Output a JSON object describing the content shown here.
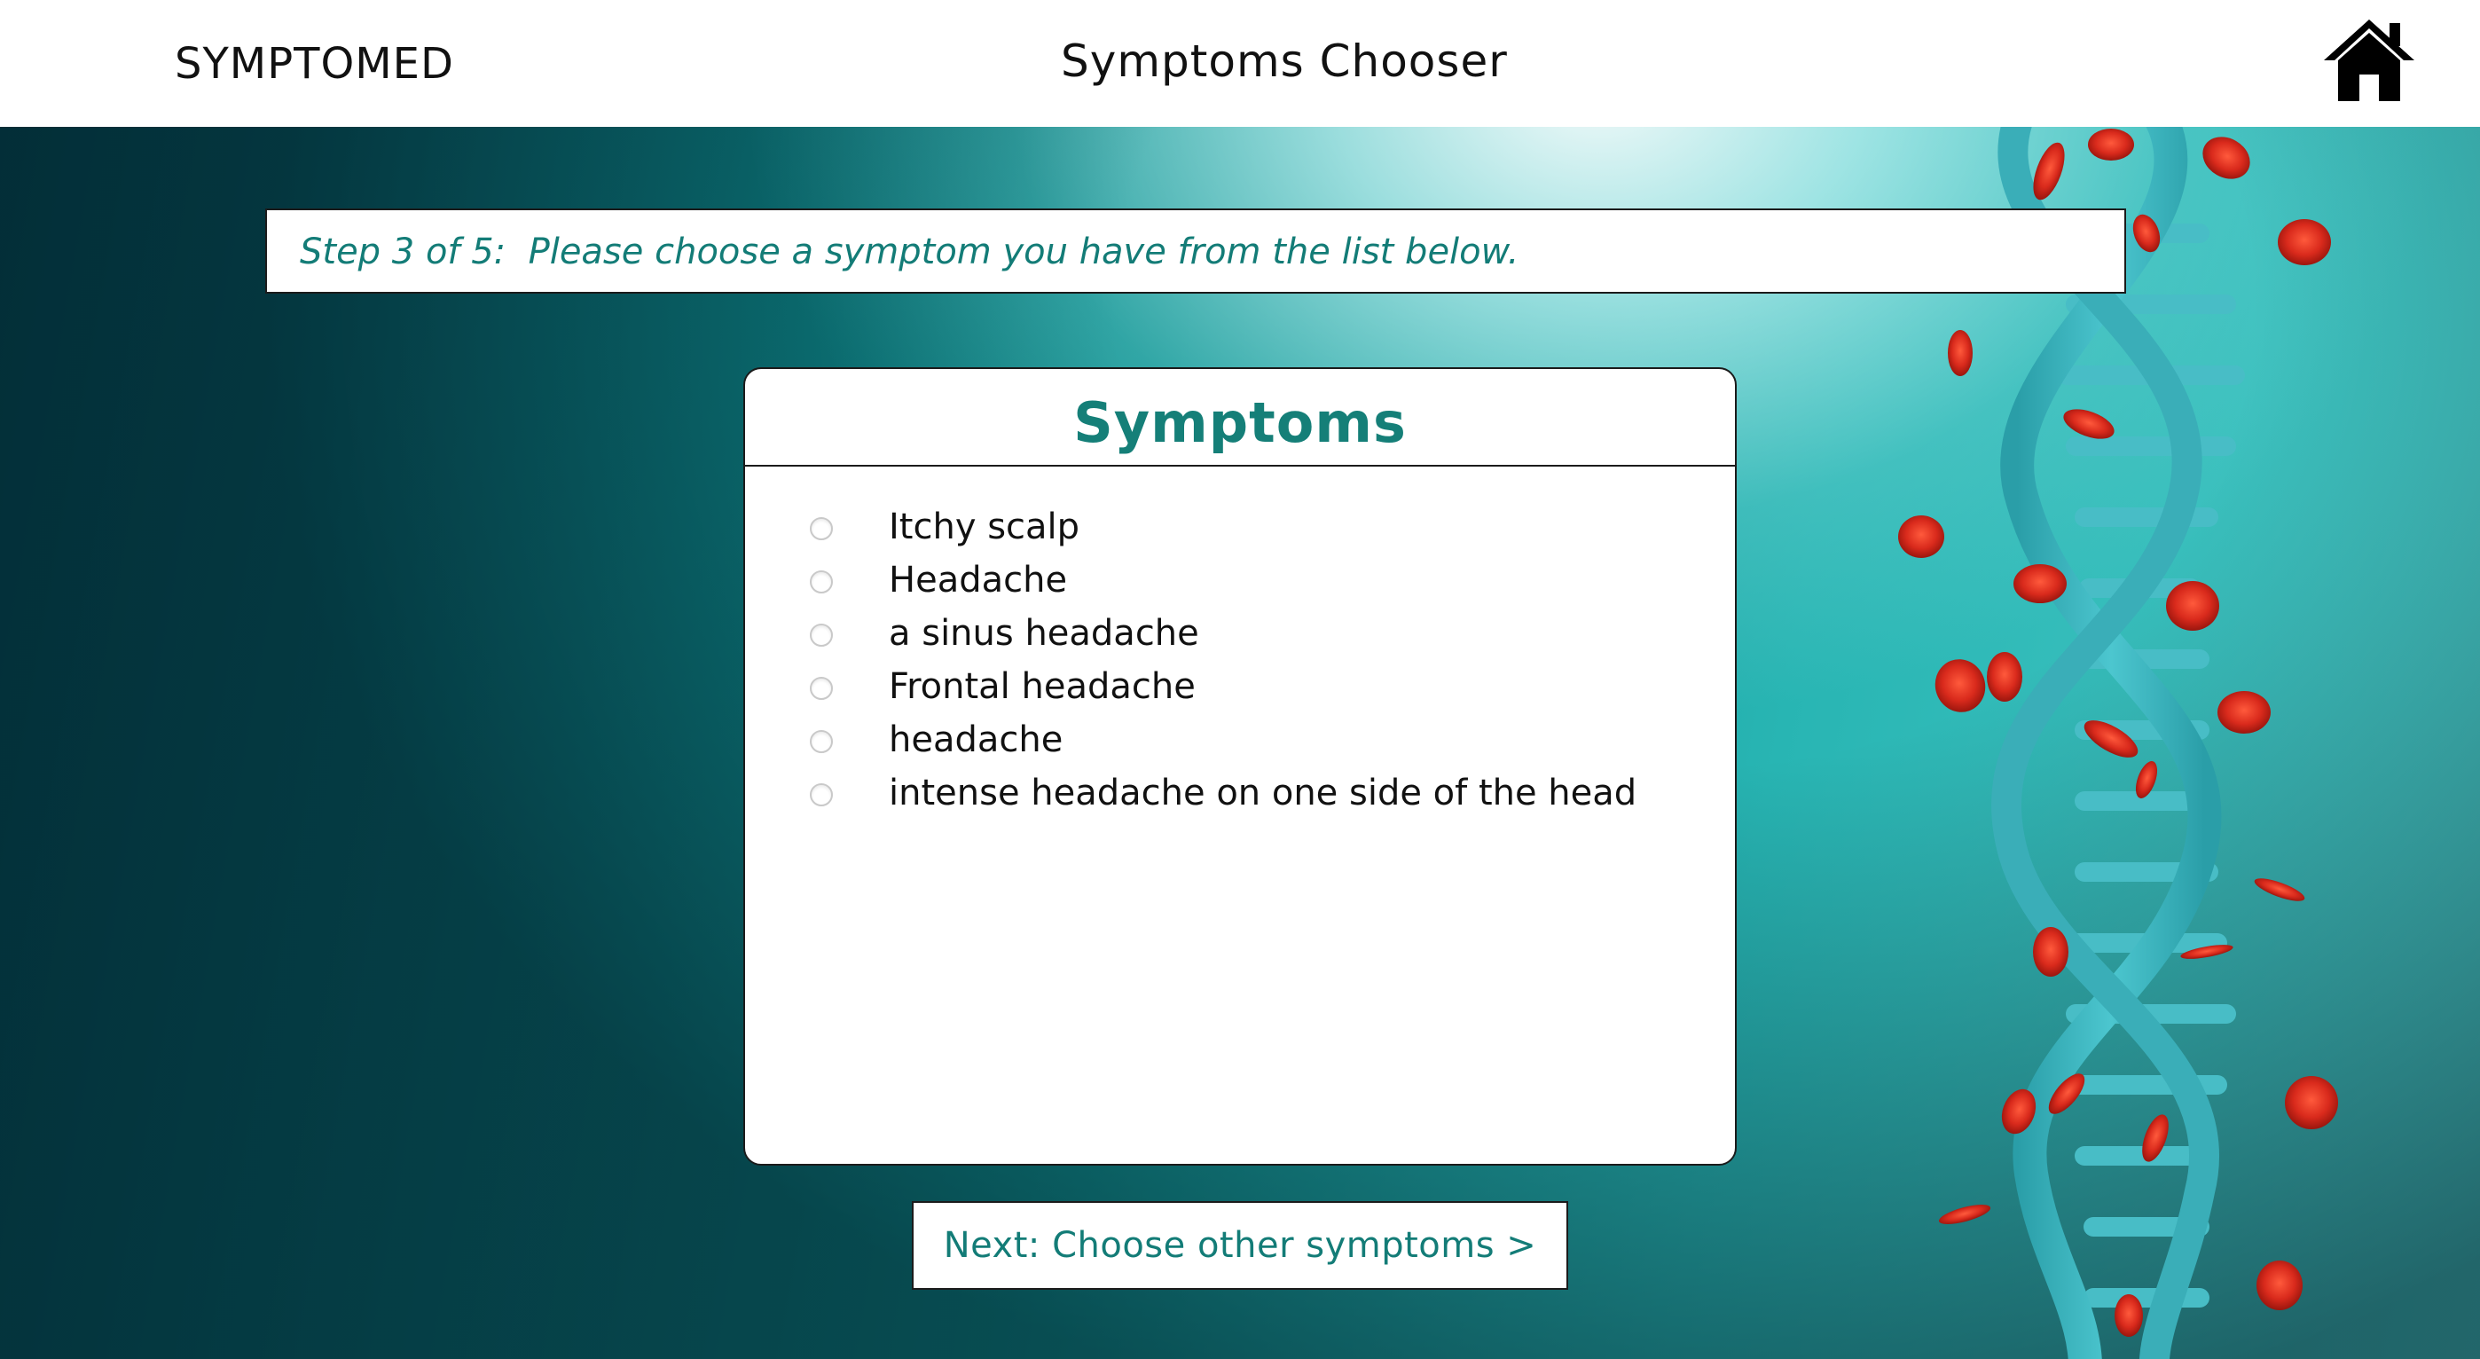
{
  "header": {
    "brand": "SYMPTOMED",
    "title": "Symptoms Chooser",
    "home_icon": "home-icon"
  },
  "step": {
    "text": "Step 3 of 5:  Please choose a symptom you have from the list below."
  },
  "panel": {
    "title": "Symptoms",
    "symptoms": [
      {
        "label": "Itchy scalp",
        "selected": false
      },
      {
        "label": "Headache",
        "selected": false
      },
      {
        "label": "a sinus headache",
        "selected": false
      },
      {
        "label": "Frontal headache",
        "selected": false
      },
      {
        "label": "headache",
        "selected": false
      },
      {
        "label": "intense headache on one side of the head",
        "selected": false
      }
    ]
  },
  "actions": {
    "next_label": "Next: Choose other symptoms >"
  },
  "colors": {
    "accent": "#137c77",
    "background_dark": "#064e57",
    "background_light": "#4ccbc8",
    "dna": "#3fb8c2",
    "blood_cell": "#d92a1c"
  }
}
